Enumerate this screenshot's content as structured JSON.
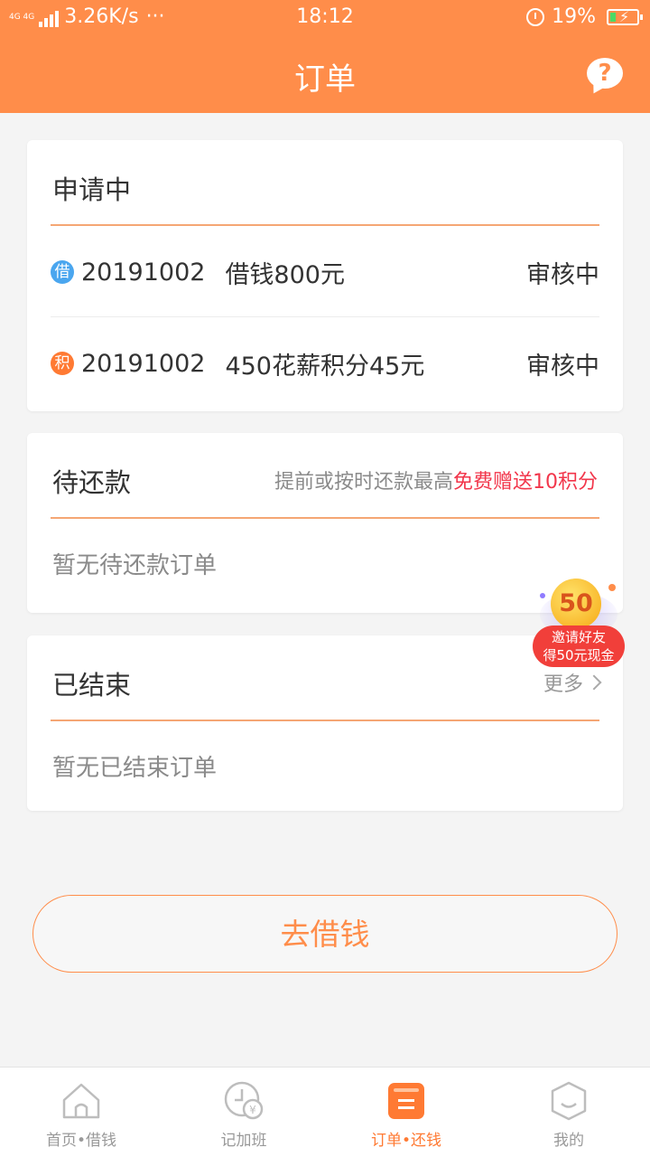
{
  "status_bar": {
    "network": "4G 4G",
    "speed": "3.26K/s",
    "more": "···",
    "time": "18:12",
    "battery": "19%"
  },
  "nav": {
    "title": "订单",
    "help": "?"
  },
  "applying": {
    "title": "申请中",
    "rows": [
      {
        "badge": "借",
        "number": "20191002",
        "desc": "借钱800元",
        "status": "审核中",
        "badge_color": "#4aa6ef"
      },
      {
        "badge": "积",
        "number": "20191002",
        "desc": "450花薪积分45元",
        "status": "审核中",
        "badge_color": "#ff7a33"
      }
    ]
  },
  "pending": {
    "title": "待还款",
    "promo_prefix": "提前或按时还款最高",
    "promo_highlight": "免费赠送10积分",
    "empty": "暂无待还款订单"
  },
  "finished": {
    "title": "已结束",
    "more": "更多",
    "empty": "暂无已结束订单"
  },
  "invite_badge": {
    "coin": "50",
    "line1": "邀请好友",
    "line2": "得50元现金"
  },
  "borrow_button": "去借钱",
  "tabs": [
    {
      "label": "首页•借钱",
      "icon": "home-icon"
    },
    {
      "label": "记加班",
      "icon": "clock-yen-icon"
    },
    {
      "label": "订单•还钱",
      "icon": "order-icon"
    },
    {
      "label": "我的",
      "icon": "profile-face-icon"
    }
  ],
  "colors": {
    "accent": "#ff8d4a",
    "highlight": "#f2364b",
    "active_tab": "#ff7a33"
  }
}
